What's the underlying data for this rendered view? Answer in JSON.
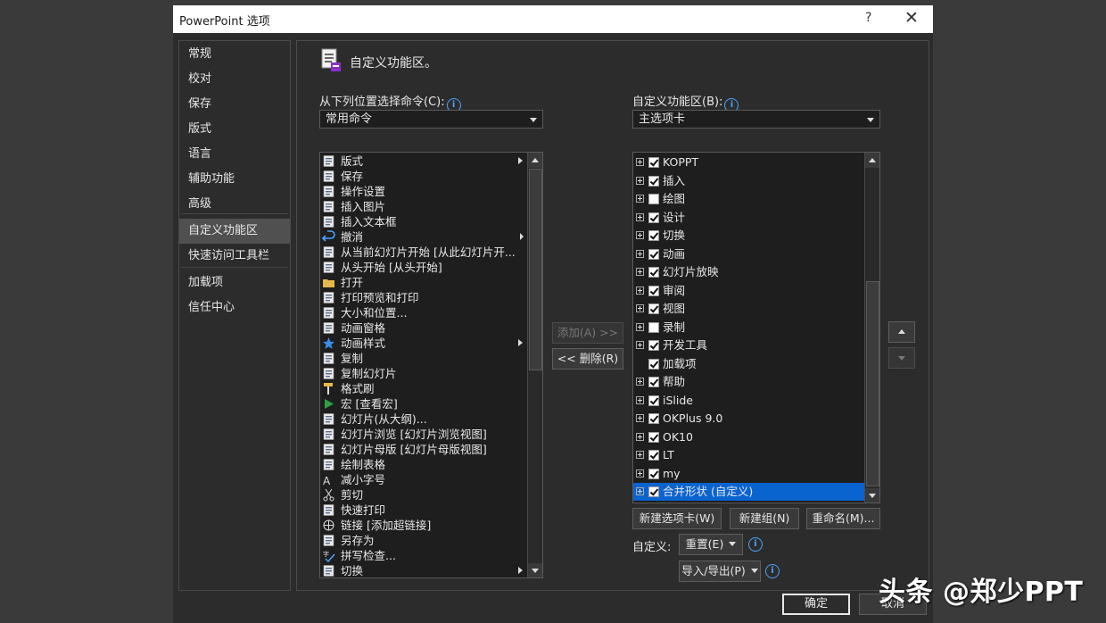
{
  "window": {
    "title": "PowerPoint 选项",
    "help_glyph": "?",
    "close_glyph": "✕"
  },
  "nav": {
    "items": [
      {
        "label": "常规"
      },
      {
        "label": "校对"
      },
      {
        "label": "保存"
      },
      {
        "label": "版式"
      },
      {
        "label": "语言"
      },
      {
        "label": "辅助功能"
      },
      {
        "label": "高级"
      },
      {
        "label": "自定义功能区",
        "selected": true
      },
      {
        "label": "快速访问工具栏"
      },
      {
        "label": "加载项"
      },
      {
        "label": "信任中心"
      }
    ]
  },
  "heading": {
    "title": "自定义功能区。",
    "icon": "customize-ribbon-icon"
  },
  "left": {
    "choose_label": "从下列位置选择命令(C):",
    "choose_value": "常用命令",
    "commands": [
      {
        "label": "版式",
        "icon": "layout-icon",
        "submenu": true
      },
      {
        "label": "保存",
        "icon": "save-icon"
      },
      {
        "label": "操作设置",
        "icon": "action-settings-icon"
      },
      {
        "label": "插入图片",
        "icon": "insert-picture-icon"
      },
      {
        "label": "插入文本框",
        "icon": "text-box-icon"
      },
      {
        "label": "撤消",
        "icon": "undo-icon",
        "split": true
      },
      {
        "label": "从当前幻灯片开始 [从此幻灯片开...",
        "icon": "slideshow-current-icon"
      },
      {
        "label": "从头开始 [从头开始]",
        "icon": "slideshow-start-icon"
      },
      {
        "label": "打开",
        "icon": "open-folder-icon"
      },
      {
        "label": "打印预览和打印",
        "icon": "print-preview-icon"
      },
      {
        "label": "大小和位置...",
        "icon": "size-position-icon"
      },
      {
        "label": "动画窗格",
        "icon": "animation-pane-icon"
      },
      {
        "label": "动画样式",
        "icon": "animation-star-icon",
        "submenu": true
      },
      {
        "label": "复制",
        "icon": "copy-icon"
      },
      {
        "label": "复制幻灯片",
        "icon": "duplicate-slide-icon"
      },
      {
        "label": "格式刷",
        "icon": "format-painter-icon"
      },
      {
        "label": "宏 [查看宏]",
        "icon": "macro-play-icon"
      },
      {
        "label": "幻灯片(从大纲)...",
        "icon": "slides-from-outline-icon"
      },
      {
        "label": "幻灯片浏览 [幻灯片浏览视图]",
        "icon": "slide-sorter-icon"
      },
      {
        "label": "幻灯片母版 [幻灯片母版视图]",
        "icon": "slide-master-icon"
      },
      {
        "label": "绘制表格",
        "icon": "draw-table-icon"
      },
      {
        "label": "减小字号",
        "icon": "decrease-font-icon"
      },
      {
        "label": "剪切",
        "icon": "cut-icon"
      },
      {
        "label": "快速打印",
        "icon": "quick-print-icon"
      },
      {
        "label": "链接 [添加超链接]",
        "icon": "link-icon"
      },
      {
        "label": "另存为",
        "icon": "save-as-icon"
      },
      {
        "label": "拼写检查...",
        "icon": "spell-check-icon"
      },
      {
        "label": "切换",
        "icon": "transition-icon",
        "submenu": true
      }
    ]
  },
  "middle": {
    "add_label": "添加(A) >>",
    "remove_label": "<< 删除(R)"
  },
  "right": {
    "customize_label": "自定义功能区(B):",
    "customize_value": "主选项卡",
    "tabs": [
      {
        "label": "KOPPT",
        "checked": true,
        "expandable": true
      },
      {
        "label": "插入",
        "checked": true,
        "expandable": true
      },
      {
        "label": "绘图",
        "checked": false,
        "expandable": true
      },
      {
        "label": "设计",
        "checked": true,
        "expandable": true
      },
      {
        "label": "切换",
        "checked": true,
        "expandable": true
      },
      {
        "label": "动画",
        "checked": true,
        "expandable": true
      },
      {
        "label": "幻灯片放映",
        "checked": true,
        "expandable": true
      },
      {
        "label": "审阅",
        "checked": true,
        "expandable": true
      },
      {
        "label": "视图",
        "checked": true,
        "expandable": true
      },
      {
        "label": "录制",
        "checked": false,
        "expandable": true
      },
      {
        "label": "开发工具",
        "checked": true,
        "expandable": true
      },
      {
        "label": "加载项",
        "checked": true,
        "expandable": false
      },
      {
        "label": "帮助",
        "checked": true,
        "expandable": true
      },
      {
        "label": "iSlide",
        "checked": true,
        "expandable": true
      },
      {
        "label": "OKPlus 9.0",
        "checked": true,
        "expandable": true
      },
      {
        "label": "OK10",
        "checked": true,
        "expandable": true
      },
      {
        "label": "LT",
        "checked": true,
        "expandable": true
      },
      {
        "label": "my",
        "checked": true,
        "expandable": true
      },
      {
        "label": "合并形状 (自定义)",
        "checked": true,
        "expandable": true,
        "selected": true
      }
    ],
    "new_tab_label": "新建选项卡(W)",
    "new_group_label": "新建组(N)",
    "rename_label": "重命名(M)...",
    "customize_row_label": "自定义:",
    "reset_label": "重置(E)",
    "import_export_label": "导入/导出(P)"
  },
  "footer": {
    "ok_label": "确定",
    "cancel_label": "取消"
  },
  "watermark": "头条 @郑少PPT",
  "colors": {
    "selection": "#0a64d0",
    "info": "#4aa3ff",
    "background": "#2c2c2c"
  }
}
